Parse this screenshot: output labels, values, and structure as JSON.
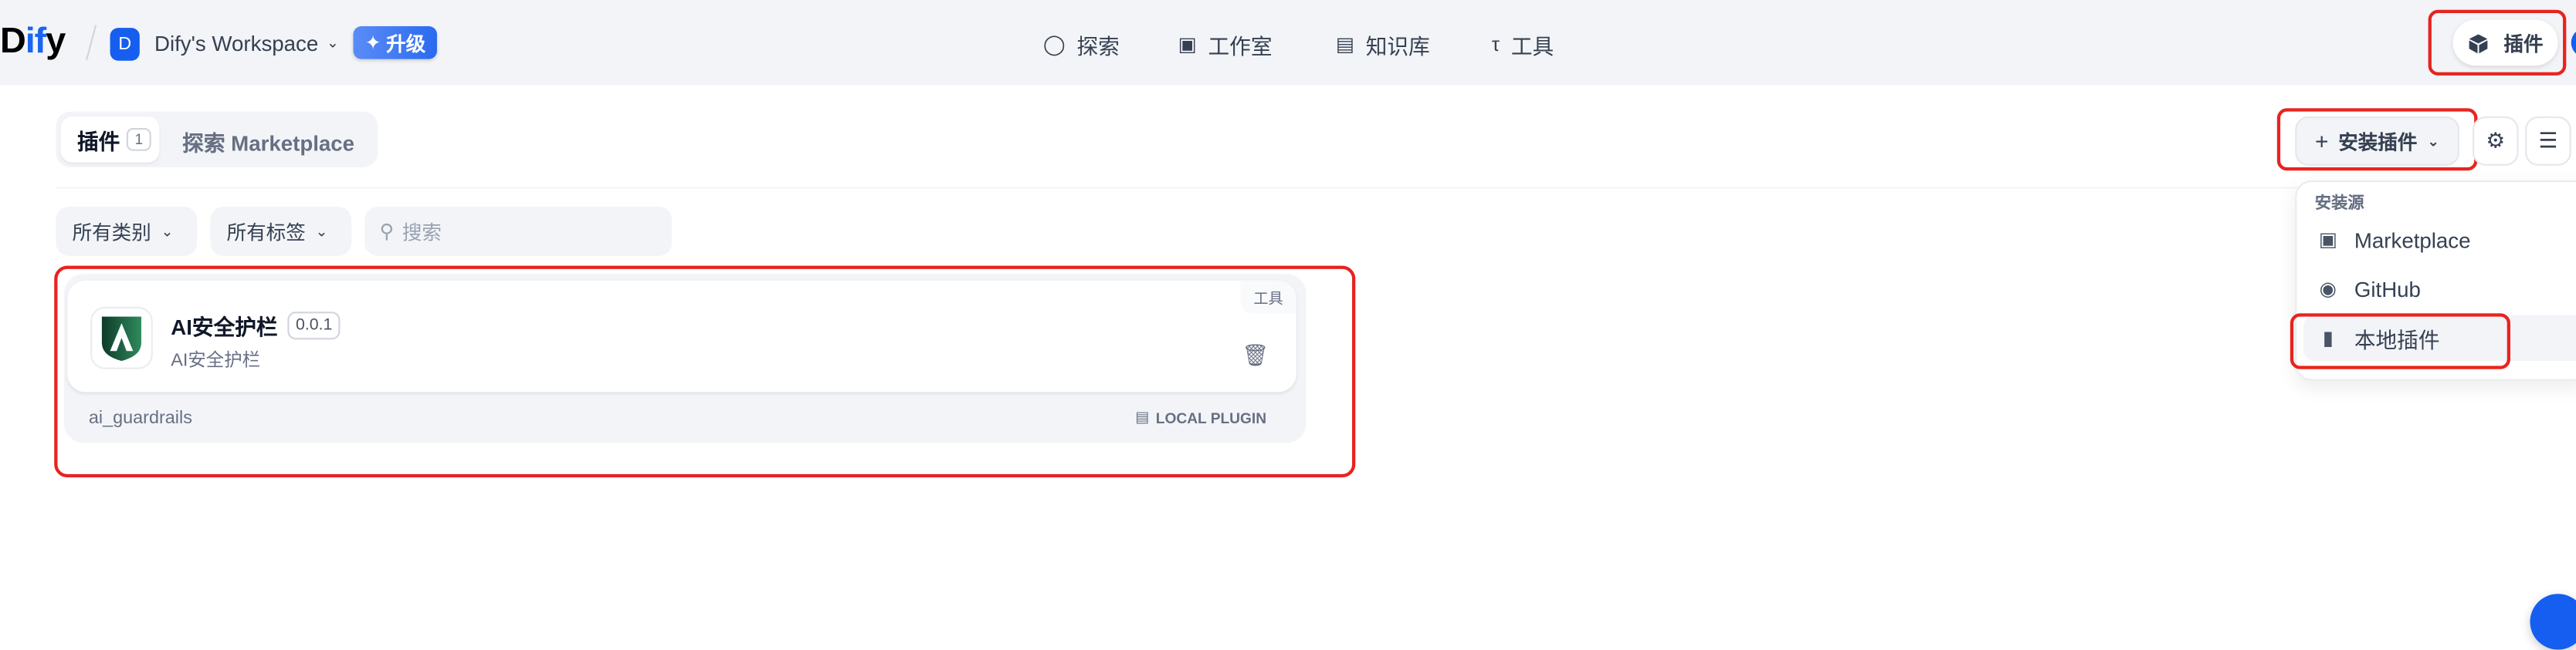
{
  "header": {
    "logo": {
      "d": "D",
      "if": "if",
      "y": "y"
    },
    "workspace": {
      "avatar": "D",
      "name": "Dify's Workspace"
    },
    "upgrade_label": "升级",
    "nav": [
      {
        "label": "探索",
        "icon": "explore-icon"
      },
      {
        "label": "工作室",
        "icon": "robot-icon"
      },
      {
        "label": "知识库",
        "icon": "book-icon"
      },
      {
        "label": "工具",
        "icon": "hammer-icon"
      }
    ],
    "plugins_label": "插件"
  },
  "tabs": {
    "plugins": "插件",
    "plugins_count": "1",
    "marketplace": "探索 Marketplace"
  },
  "toolbar": {
    "install_label": "安装插件"
  },
  "filters": {
    "category": "所有类别",
    "tags": "所有标签",
    "search_placeholder": "搜索"
  },
  "plugin": {
    "title": "AI安全护栏",
    "version": "0.0.1",
    "description": "AI安全护栏",
    "category": "工具",
    "id": "ai_guardrails",
    "source": "LOCAL PLUGIN"
  },
  "install_menu": {
    "label": "安装源",
    "items": [
      {
        "label": "Marketplace",
        "icon": "marketplace-icon"
      },
      {
        "label": "GitHub",
        "icon": "github-icon"
      },
      {
        "label": "本地插件",
        "icon": "local-file-icon"
      }
    ]
  },
  "colors": {
    "accent": "#155eef",
    "highlight": "#e8231f",
    "header_bg": "#f2f4f7"
  }
}
